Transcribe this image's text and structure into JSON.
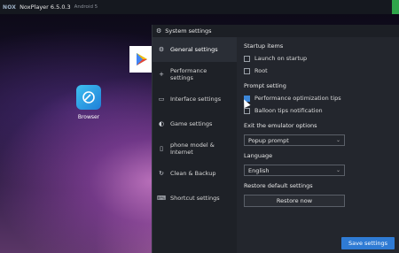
{
  "app": {
    "logo_text": "NOX",
    "title": "NoxPlayer 6.5.0.3",
    "android_version": "Android 5"
  },
  "desktop": {
    "browser_label": "Browser"
  },
  "dialog": {
    "title": "System settings",
    "nav": [
      {
        "label": "General settings",
        "icon": "gear-icon"
      },
      {
        "label": "Performance settings",
        "icon": "plus-icon"
      },
      {
        "label": "Interface settings",
        "icon": "window-icon"
      },
      {
        "label": "Game settings",
        "icon": "gamepad-icon"
      },
      {
        "label": "phone model & Internet",
        "icon": "phone-icon"
      },
      {
        "label": "Clean & Backup",
        "icon": "refresh-icon"
      },
      {
        "label": "Shortcut settings",
        "icon": "keyboard-icon"
      }
    ],
    "startup": {
      "title": "Startup items",
      "launch_on_startup": "Launch on startup",
      "root": "Root"
    },
    "prompt": {
      "title": "Prompt setting",
      "performance_tips": "Performance optimization tips",
      "balloon_tips": "Balloon tips notification"
    },
    "exit": {
      "title": "Exit the emulator options",
      "value": "Popup prompt"
    },
    "language": {
      "title": "Language",
      "value": "English"
    },
    "restore": {
      "title": "Restore default settings",
      "button": "Restore now"
    },
    "save_button": "Save settings"
  },
  "colors": {
    "accent": "#2f7bd4",
    "dialog_bg": "#23262d",
    "nav_bg": "#1e2127"
  }
}
